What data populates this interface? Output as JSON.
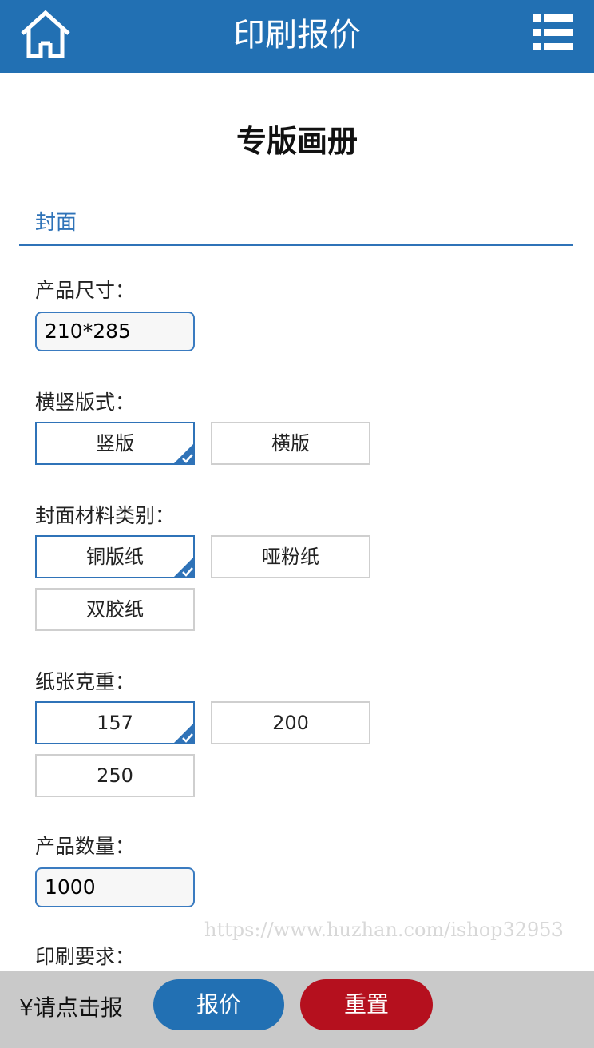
{
  "header": {
    "title": "印刷报价",
    "home_icon": "home-icon",
    "menu_icon": "list-menu-icon",
    "bg_color": "#2270b3"
  },
  "page_title": "专版画册",
  "section": {
    "label": "封面"
  },
  "product_size": {
    "label": "产品尺寸：",
    "value": "210*285"
  },
  "orientation": {
    "label": "横竖版式：",
    "options": [
      {
        "label": "竖版",
        "selected": true
      },
      {
        "label": "横版",
        "selected": false
      }
    ]
  },
  "cover_material": {
    "label": "封面材料类别：",
    "options": [
      {
        "label": "铜版纸",
        "selected": true
      },
      {
        "label": "哑粉纸",
        "selected": false
      },
      {
        "label": "双胶纸",
        "selected": false
      }
    ]
  },
  "paper_weight": {
    "label": "纸张克重：",
    "options": [
      {
        "label": "157",
        "selected": true
      },
      {
        "label": "200",
        "selected": false
      },
      {
        "label": "250",
        "selected": false
      }
    ]
  },
  "quantity": {
    "label": "产品数量：",
    "value": "1000"
  },
  "print_requirements": {
    "label": "印刷要求："
  },
  "footer": {
    "price_text": "¥请点击报",
    "quote_button": "报价",
    "reset_button": "重置",
    "quote_color": "#2270b3",
    "reset_color": "#b5101e"
  },
  "watermark": "https://www.huzhan.com/ishop32953"
}
